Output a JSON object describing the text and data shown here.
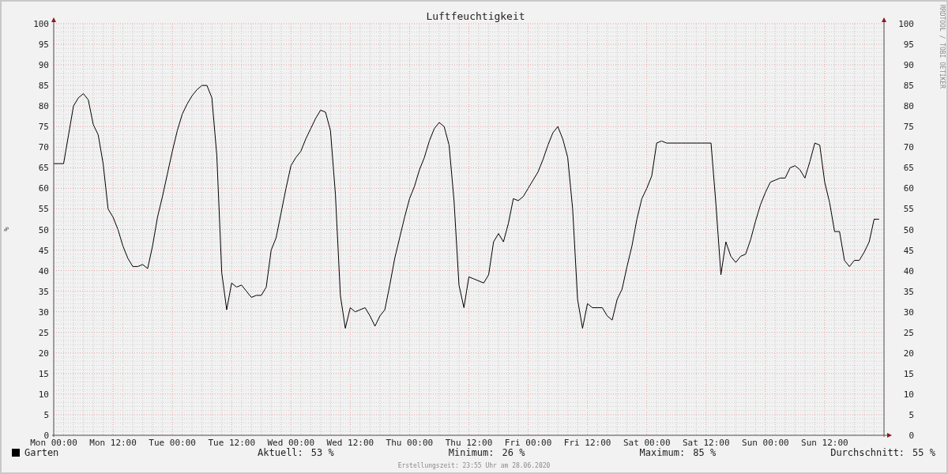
{
  "chart": {
    "watermark": "RRDTOOL / TOBI OETIKER",
    "right_axis_labels": [
      "100",
      "95",
      "90",
      "85",
      "80",
      "75",
      "70",
      "65",
      "60",
      "55",
      "50",
      "45",
      "40",
      "35",
      "30",
      "25",
      "20",
      "15",
      "10",
      "5",
      "0"
    ],
    "chart_data": {
      "type": "line",
      "title": "Luftfeuchtigkeit",
      "ylabel": "%",
      "grid": true,
      "ylim": [
        0,
        100
      ],
      "yticks": [
        0,
        5,
        10,
        15,
        20,
        25,
        30,
        35,
        40,
        45,
        50,
        55,
        60,
        65,
        70,
        75,
        80,
        85,
        90,
        95,
        100
      ],
      "categories": [
        "Mon 00:00",
        null,
        null,
        null,
        null,
        null,
        null,
        null,
        null,
        null,
        null,
        null,
        "Mon 12:00",
        null,
        null,
        null,
        null,
        null,
        null,
        null,
        null,
        null,
        null,
        null,
        "Tue 00:00",
        null,
        null,
        null,
        null,
        null,
        null,
        null,
        null,
        null,
        null,
        null,
        "Tue 12:00",
        null,
        null,
        null,
        null,
        null,
        null,
        null,
        null,
        null,
        null,
        null,
        "Wed 00:00",
        null,
        null,
        null,
        null,
        null,
        null,
        null,
        null,
        null,
        null,
        null,
        "Wed 12:00",
        null,
        null,
        null,
        null,
        null,
        null,
        null,
        null,
        null,
        null,
        null,
        "Thu 00:00",
        null,
        null,
        null,
        null,
        null,
        null,
        null,
        null,
        null,
        null,
        null,
        "Thu 12:00",
        null,
        null,
        null,
        null,
        null,
        null,
        null,
        null,
        null,
        null,
        null,
        "Fri 00:00",
        null,
        null,
        null,
        null,
        null,
        null,
        null,
        null,
        null,
        null,
        null,
        "Fri 12:00",
        null,
        null,
        null,
        null,
        null,
        null,
        null,
        null,
        null,
        null,
        null,
        "Sat 00:00",
        null,
        null,
        null,
        null,
        null,
        null,
        null,
        null,
        null,
        null,
        null,
        "Sat 12:00",
        null,
        null,
        null,
        null,
        null,
        null,
        null,
        null,
        null,
        null,
        null,
        "Sun 00:00",
        null,
        null,
        null,
        null,
        null,
        null,
        null,
        null,
        null,
        null,
        null,
        "Sun 12:00",
        null,
        null,
        null,
        null,
        null,
        null,
        null,
        null,
        null,
        null,
        null
      ],
      "series": [
        {
          "name": "Garten",
          "color": "#000000",
          "values": [
            66,
            66,
            66,
            73,
            80,
            82,
            83,
            81.5,
            75.5,
            73,
            66,
            55,
            53,
            50,
            46,
            43,
            41,
            41,
            41.5,
            40.5,
            46,
            53,
            58,
            63.5,
            69,
            74,
            78,
            80.5,
            82.5,
            84,
            85,
            85,
            82,
            68,
            39.5,
            30.5,
            37,
            36,
            36.5,
            35,
            33.5,
            34,
            34,
            36,
            45,
            48,
            54,
            60,
            65.5,
            67.5,
            69,
            72,
            74.5,
            77,
            79,
            78.5,
            74,
            58.5,
            34,
            26,
            31,
            30,
            30.5,
            31,
            29,
            26.5,
            29,
            30.5,
            36.5,
            43,
            48,
            53,
            57.5,
            60.5,
            64.5,
            67.5,
            71.5,
            74.5,
            76,
            75,
            70.5,
            57,
            36.5,
            31,
            38.5,
            38,
            37.5,
            37,
            39,
            47,
            49,
            47,
            51.5,
            57.5,
            57,
            58,
            60,
            62,
            64,
            67,
            70.5,
            73.5,
            75,
            72,
            67.5,
            55,
            33,
            26,
            32,
            31,
            31,
            31,
            29,
            28,
            33,
            35.5,
            41,
            46,
            52.5,
            57.5,
            60,
            63,
            71,
            71.5,
            71,
            71,
            71,
            71,
            71,
            71,
            71,
            71,
            71,
            71,
            56,
            39,
            47,
            43.5,
            42,
            43.5,
            44,
            47.5,
            52,
            56,
            59,
            61.5,
            62,
            62.5,
            62.5,
            65,
            65.5,
            64.5,
            62.5,
            66.5,
            71,
            70.5,
            61.5,
            56.5,
            49.5,
            49.5,
            42.5,
            41,
            42.5,
            42.5,
            44.5,
            47,
            52.5,
            52.5
          ]
        }
      ]
    }
  },
  "legend": {
    "stats": [
      {
        "label": "Aktuell:",
        "value": "53 %"
      },
      {
        "label": "Minimum:",
        "value": "26 %"
      },
      {
        "label": "Maximum:",
        "value": "85 %"
      },
      {
        "label": "Durchschnitt:",
        "value": "55 %"
      }
    ]
  },
  "footer": "Erstellungszeit: 23:55 Uhr am 28.06.2020"
}
